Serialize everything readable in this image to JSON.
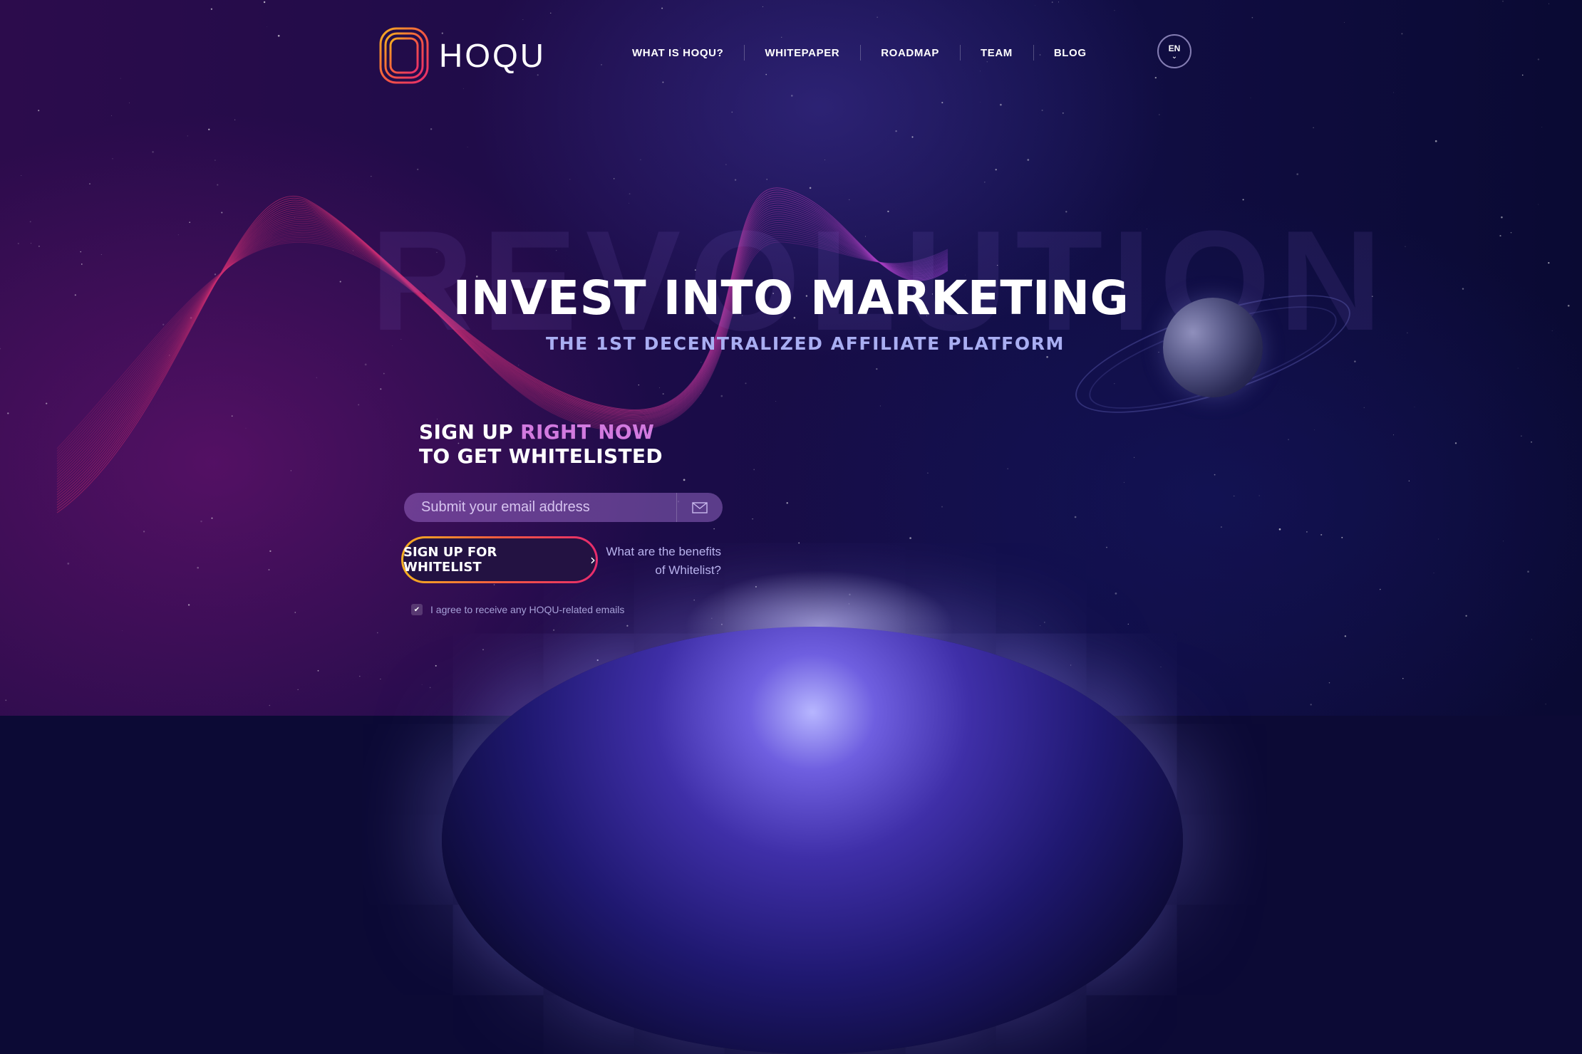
{
  "brand": {
    "name": "HOQU",
    "colors": {
      "gradient_start": "#f5b020",
      "gradient_mid": "#f35a40",
      "gradient_end": "#e72b6d",
      "accent_pink": "#d27adf",
      "subtitle": "#a9aef2"
    }
  },
  "nav": {
    "items": [
      "WHAT IS HOQU?",
      "WHITEPAPER",
      "ROADMAP",
      "TEAM",
      "BLOG"
    ]
  },
  "language": {
    "code": "EN",
    "icon": "chevron-down-icon"
  },
  "hero": {
    "background_word": "REVOLUTION",
    "title": "INVEST INTO MARKETING",
    "subtitle": "THE 1ST DECENTRALIZED AFFILIATE PLATFORM"
  },
  "signup": {
    "heading_line1_a": "SIGN UP ",
    "heading_line1_b": "RIGHT NOW",
    "heading_line2": "TO GET WHITELISTED",
    "email_placeholder": "Submit your email address",
    "email_icon": "envelope-icon",
    "button_label": "SIGN UP FOR WHITELIST",
    "button_icon": "chevron-right-icon",
    "benefits_line1": "What are the benefits",
    "benefits_line2": "of Whitelist?",
    "agree_label": "I agree to receive any HOQU-related emails",
    "agree_checked": true
  }
}
